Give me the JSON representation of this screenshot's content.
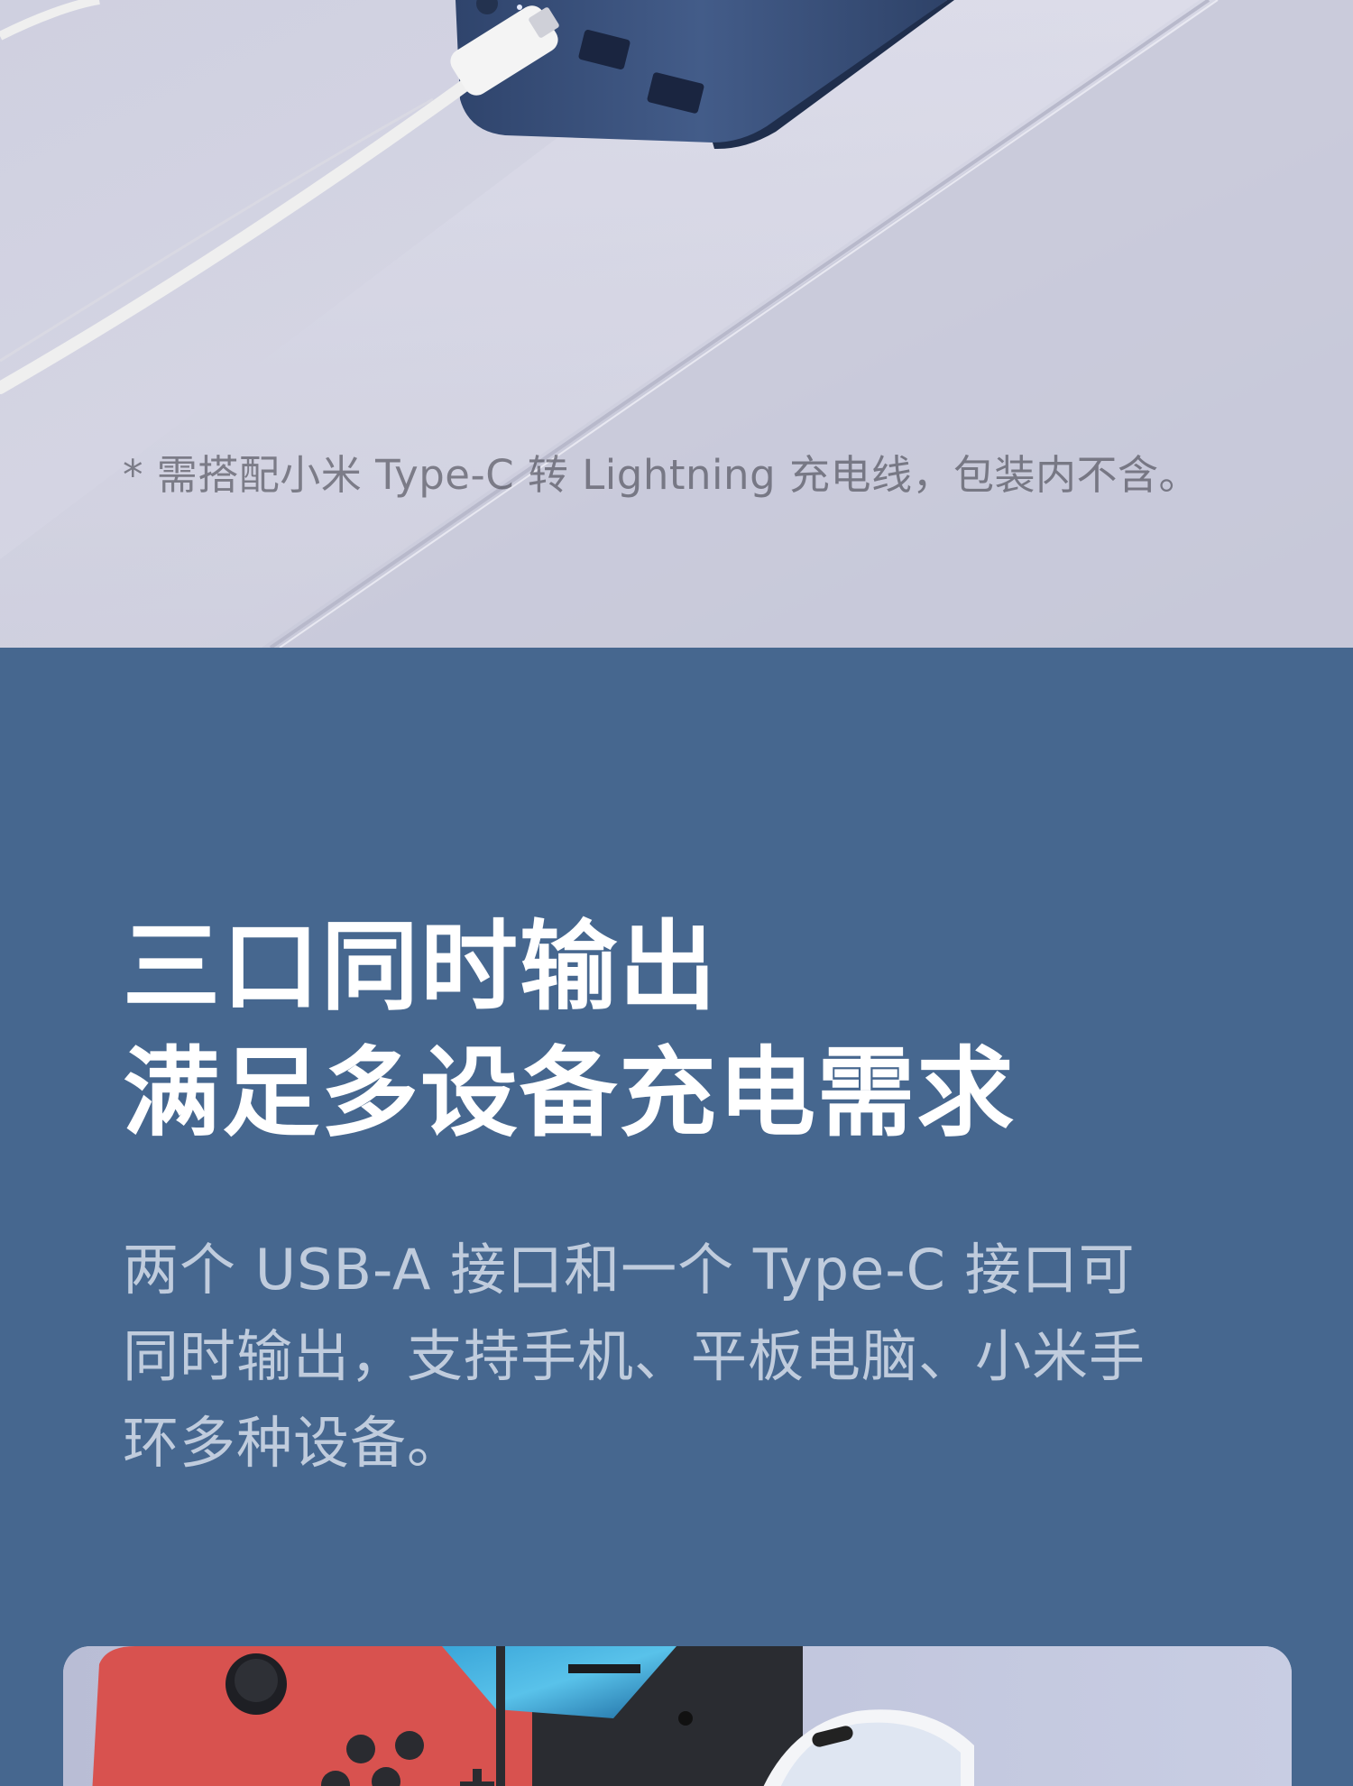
{
  "hero": {
    "footnote": "*  需搭配小米 Type-C 转 Lightning 充电线，包装内不含。"
  },
  "feature": {
    "headline_lines": [
      "三口同时输出",
      "满足多设备充电需求"
    ],
    "body_lines": [
      "两个 USB-A 接口和一个 Type-C 接口可",
      "同时输出，支持手机、平板电脑、小米手",
      "环多种设备。"
    ]
  },
  "colors": {
    "band_background": "#46678f",
    "hero_background": "#d3d3e2",
    "power_bank_body": "#3f5782",
    "cable": "#f2f2f2",
    "console_red": "#d8524f"
  },
  "icons": {
    "product": "power-bank-illustration",
    "cable": "usb-cable-illustration",
    "console": "handheld-console-illustration",
    "phone": "smartphone-illustration"
  }
}
